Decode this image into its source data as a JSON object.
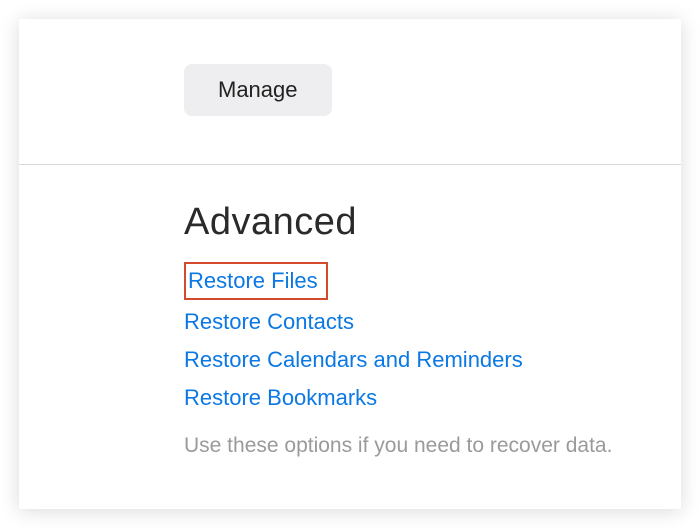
{
  "top": {
    "manage_label": "Manage"
  },
  "advanced": {
    "heading": "Advanced",
    "links": {
      "restore_files": "Restore Files",
      "restore_contacts": "Restore Contacts",
      "restore_calendars": "Restore Calendars and Reminders",
      "restore_bookmarks": "Restore Bookmarks"
    },
    "note": "Use these options if you need to recover data."
  }
}
